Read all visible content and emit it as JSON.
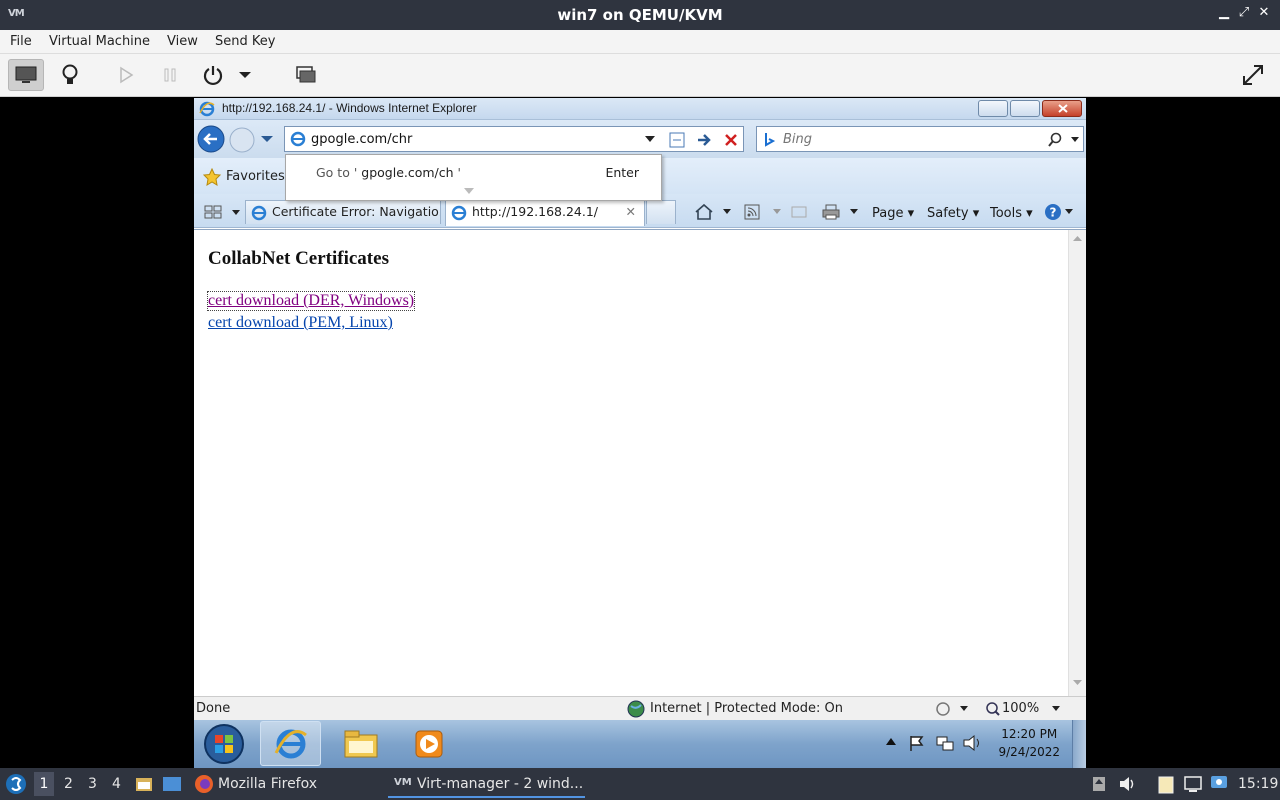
{
  "vm": {
    "title": "win7 on QEMU/KVM",
    "menu": [
      "File",
      "Virtual Machine",
      "View",
      "Send Key"
    ]
  },
  "ie": {
    "window_title": "http://192.168.24.1/ - Windows Internet Explorer",
    "address_value": "gpogle.com/chr",
    "search_placeholder": "Bing",
    "autocomplete": {
      "goto_prefix": "Go to '",
      "goto_text": "gpogle.com/ch",
      "goto_suffix": "'",
      "enter": "Enter"
    },
    "favorites_label": "Favorites",
    "tabs": [
      {
        "label": "Certificate Error: Navigatio..."
      },
      {
        "label": "http://192.168.24.1/"
      }
    ],
    "commands": [
      "Page",
      "Safety",
      "Tools"
    ],
    "page": {
      "heading": "CollabNet Certificates",
      "links": [
        "cert download (DER, Windows)",
        "cert download (PEM, Linux)"
      ]
    },
    "status": {
      "left": "Done",
      "zone": "Internet | Protected Mode: On",
      "zoom": "100%"
    }
  },
  "win_taskbar": {
    "time": "12:20 PM",
    "date": "9/24/2022"
  },
  "host_taskbar": {
    "workspaces": [
      "1",
      "2",
      "3",
      "4"
    ],
    "apps": [
      "Mozilla Firefox",
      "Virt-manager - 2 wind..."
    ],
    "clock": "15:19"
  }
}
